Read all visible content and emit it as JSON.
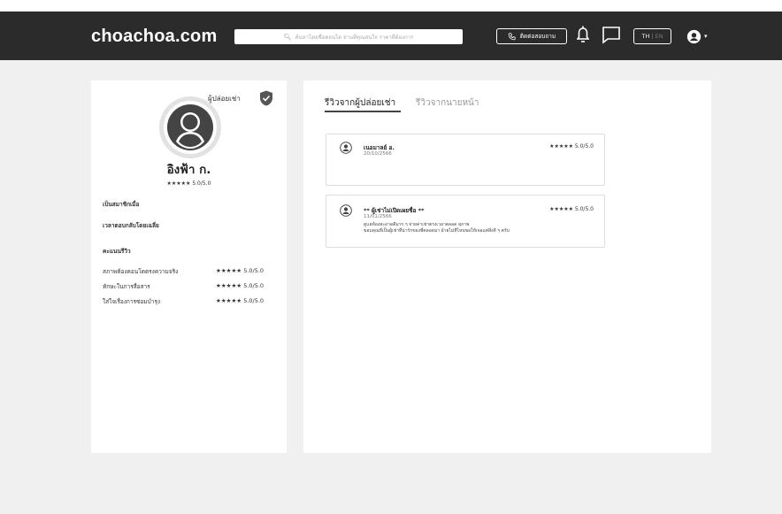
{
  "header": {
    "logo": "choachoa.com",
    "search_placeholder": "ค้นหาโดยชื่อคอนโด ย่านที่คุณสนใจ ราคาที่ต้องการ",
    "contact_label": "ติดต่อสอบถาม",
    "lang_active": "TH",
    "lang_inactive": "EN"
  },
  "profile": {
    "verified_label": "ผู้ปล่อยเช่า",
    "name": "อิงฟ้า ก.",
    "rating": "★★★★★ 5.0/5.0",
    "member_since_label": "เป็นสมาชิกเมื่อ",
    "avg_response_label": "เวลาตอบกลับโดยเฉลี่ย",
    "criteria_title": "คะแนนรีวิว",
    "criteria": [
      {
        "label": "สภาพห้องคอนโดตรงความจริง",
        "score": "★★★★★ 5.0/5.0"
      },
      {
        "label": "ทักษะในการสื่อสาร",
        "score": "★★★★★ 5.0/5.0"
      },
      {
        "label": "ใส่ใจเรื่องการซ่อมบำรุง",
        "score": "★★★★★ 5.0/5.0"
      }
    ]
  },
  "tabs": {
    "active": "รีวิวจากผู้ปล่อยเช่า",
    "inactive": "รีวิวจากนายหน้า"
  },
  "reviews": [
    {
      "name": "เนอมาลย์ อ.",
      "date": "20/10/2566",
      "score": "★★★★★ 5.0/5.0",
      "text_line1": "",
      "text_line2": ""
    },
    {
      "name": "** ผู้เช่าไม่เปิดเผยชื่อ **",
      "date": "11/01/2566",
      "score": "★★★★★ 5.0/5.0",
      "text_line1": "ดูแลห้องสะอาดดีมาก ๆ จ่ายค่าเช่าตรงเวลาตลอด สุภาพ",
      "text_line2": "ขอบคุณที่เป็นผู้เช่าที่น่ารักของพี่ตลอดมา อ้ายไม่ที่ไหนขอให้เจอแต่สิ่งดี ๆ ครับ"
    }
  ]
}
